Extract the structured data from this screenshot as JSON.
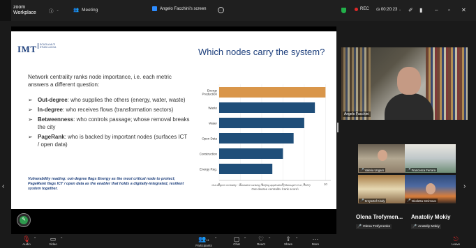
{
  "topbar": {
    "app_name_line1": "zoom",
    "app_name_line2": "Workplace",
    "meeting_label": "Meeting",
    "share_tab_label": "Angelo Facchini's screen",
    "rec_label": "REC",
    "clock": "00:20:23"
  },
  "slide": {
    "logo": "IMT",
    "logo_sub": "SCUOLA ALTI STUDI LUCCA",
    "title": "Which nodes carry the system?",
    "intro": "Network centrality ranks node importance, i.e. each metric answers a different question:",
    "bullets": [
      {
        "key": "Out-degree",
        "text": ": who supplies the others (energy, water, waste)"
      },
      {
        "key": "In-degree",
        "text": ": who receives flows (transformation sectors)"
      },
      {
        "key": "Betweenness",
        "text": ": who controls passage; whose removal breaks the city"
      },
      {
        "key": "PageRank",
        "text": ": who is backed by important nodes (surfaces ICT / open data)"
      }
    ],
    "vulnerability_note": "Vulnerability reading: out-degree flags Energy as the most critical node to protect; PageRank flags ICT / open data as the enabler that holds a digitally-integrated, resilient system together.",
    "chart_caption": "Out-degree centrality · illustrative ranking, Beijing application (Maroughi et al., 2020)"
  },
  "chart_data": {
    "type": "bar",
    "orientation": "horizontal",
    "categories": [
      "Energy Production",
      "Waste",
      "Water",
      "Open Data",
      "Construction",
      "Energy Reg."
    ],
    "values": [
      10,
      9,
      8,
      7,
      6,
      5
    ],
    "highlight_color": "#d9964a",
    "bar_color": "#1f4e79",
    "xlabel": "Out-degree centrality (rank score)",
    "xticks": [
      0,
      2,
      4,
      6,
      8,
      10
    ],
    "xlim": [
      0,
      10.5
    ]
  },
  "videos": {
    "main_name": "Angelo Facchini",
    "thumbs": [
      "Valeria Ungaro",
      "Francesca Ferrara",
      "Krzysztof Kiraly",
      "Nicoletta Smirnova"
    ],
    "name_left": "Olena Trofymen...",
    "name_right": "Anatoliy Mokiy",
    "tag_left": "Olena Trofymenko",
    "tag_right": "Anatoliy Mokiy"
  },
  "bottombar": {
    "audio": "Audio",
    "video": "Video",
    "participants": "Participants",
    "participants_count": "11",
    "chat": "Chat",
    "react": "React",
    "share": "Share",
    "more": "More",
    "leave": "Leave"
  }
}
